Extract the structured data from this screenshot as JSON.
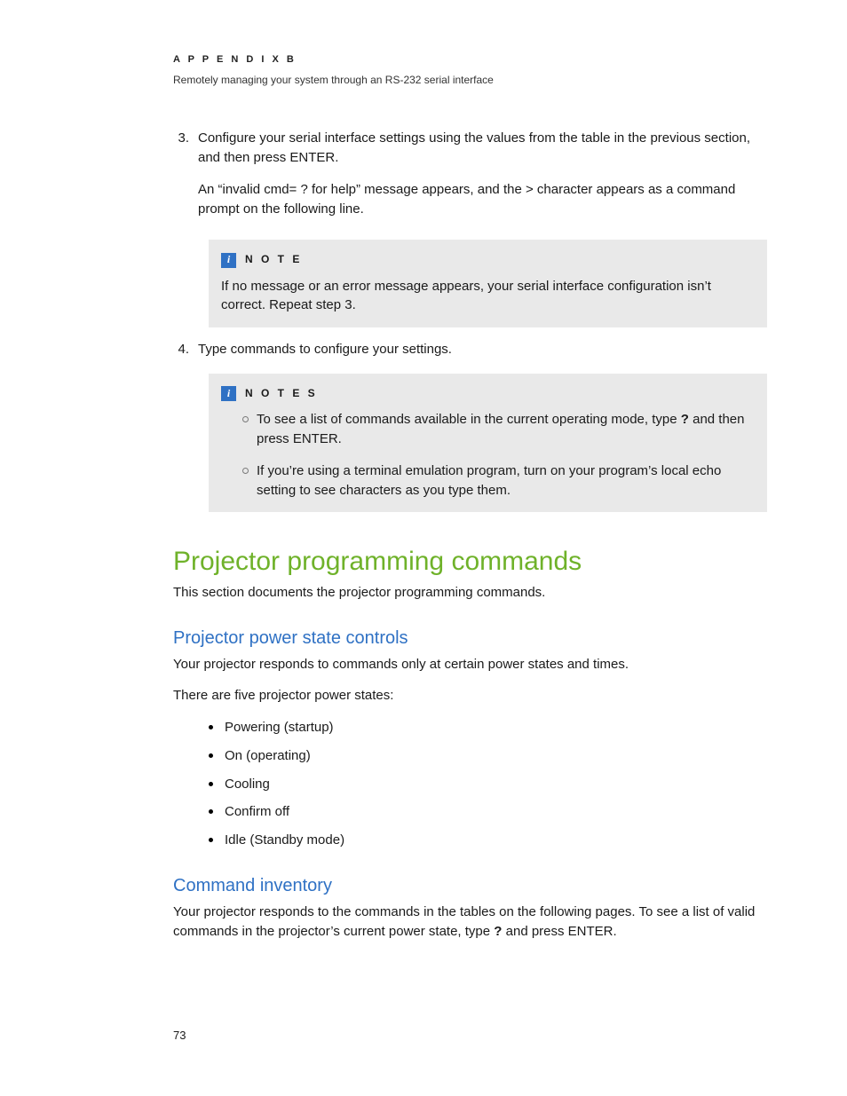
{
  "header": {
    "eyebrow": "A P P E N D I X   B",
    "subtitle": "Remotely managing your system through an RS-232 serial interface"
  },
  "steps": {
    "three": {
      "num": "3.",
      "p1": "Configure your serial interface settings using the values from the table in the previous section, and then press ENTER.",
      "p2": "An “invalid cmd= ? for help” message appears, and the > character appears as a command prompt on the following line."
    },
    "four": {
      "num": "4.",
      "p1": "Type commands to configure your settings."
    }
  },
  "callouts": {
    "note1": {
      "title": "N O T E",
      "text": "If no message or an error message appears, your serial interface configuration isn’t correct. Repeat step 3."
    },
    "note2": {
      "title": "N O T E S",
      "li1a": "To see a list of commands available in the current operating mode, type ",
      "li1b": "?",
      "li1c": " and then press ENTER.",
      "li2": "If you’re using a terminal emulation program, turn on your program’s local echo setting to see characters as you type them."
    }
  },
  "sections": {
    "h1": "Projector programming commands",
    "h1_sub": "This section documents the projector programming commands.",
    "h2a": "Projector power state controls",
    "h2a_p1": "Your projector responds to commands only at certain power states and times.",
    "h2a_p2": "There are five projector power states:",
    "states": {
      "s1": "Powering (startup)",
      "s2": "On (operating)",
      "s3": "Cooling",
      "s4": "Confirm off",
      "s5": "Idle (Standby mode)"
    },
    "h2b": "Command inventory",
    "h2b_p1a": "Your projector responds to the commands in the tables on the following pages. To see a list of valid commands in the projector’s current power state, type ",
    "h2b_p1b": "?",
    "h2b_p1c": " and press ENTER."
  },
  "page_number": "73"
}
